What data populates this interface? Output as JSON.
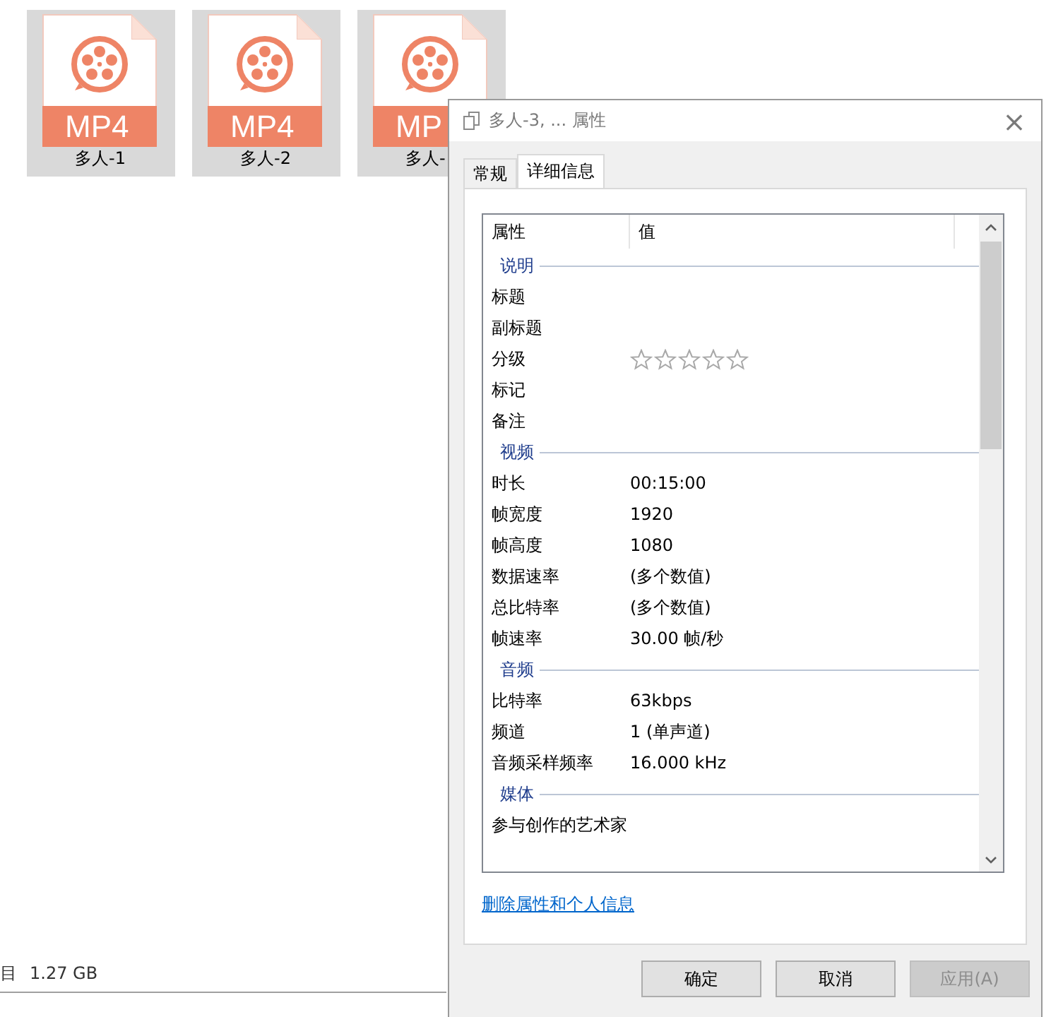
{
  "files": [
    {
      "type": "MP4",
      "name": "多人-1",
      "selected": true
    },
    {
      "type": "MP4",
      "name": "多人-2",
      "selected": true
    },
    {
      "type": "MP",
      "name": "多人-",
      "selected": true
    }
  ],
  "status_bar": {
    "items_text": "目",
    "size": "1.27 GB"
  },
  "dialog": {
    "title": "多人-3, ... 属性",
    "close": "×",
    "tabs": [
      {
        "label": "常规",
        "selected": false
      },
      {
        "label": "详细信息",
        "selected": true
      }
    ],
    "columns": [
      "属性",
      "值"
    ],
    "rows": [
      {
        "kind": "group",
        "name": "说明"
      },
      {
        "kind": "text",
        "name": "标题"
      },
      {
        "kind": "text",
        "name": "副标题"
      },
      {
        "kind": "stars",
        "name": "分级",
        "stars": 0
      },
      {
        "kind": "text",
        "name": "标记"
      },
      {
        "kind": "text",
        "name": "备注"
      },
      {
        "kind": "group",
        "name": "视频"
      },
      {
        "kind": "text",
        "name": "时长",
        "value": "00:15:00"
      },
      {
        "kind": "text",
        "name": "帧宽度",
        "value": "1920"
      },
      {
        "kind": "text",
        "name": "帧高度",
        "value": "1080"
      },
      {
        "kind": "text",
        "name": "数据速率",
        "value": "(多个数值)"
      },
      {
        "kind": "text",
        "name": "总比特率",
        "value": "(多个数值)"
      },
      {
        "kind": "text",
        "name": "帧速率",
        "value": "30.00 帧/秒"
      },
      {
        "kind": "group",
        "name": "音频"
      },
      {
        "kind": "text",
        "name": "比特率",
        "value": "63kbps"
      },
      {
        "kind": "text",
        "name": "频道",
        "value": "1 (单声道)"
      },
      {
        "kind": "text",
        "name": "音频采样频率",
        "value": "16.000 kHz"
      },
      {
        "kind": "group",
        "name": "媒体"
      },
      {
        "kind": "text",
        "name": "参与创作的艺术家"
      }
    ],
    "link": "删除属性和个人信息",
    "buttons": [
      {
        "label": "确定",
        "disabled": false
      },
      {
        "label": "取消",
        "disabled": false
      },
      {
        "label": "应用(A)",
        "disabled": true
      }
    ]
  }
}
